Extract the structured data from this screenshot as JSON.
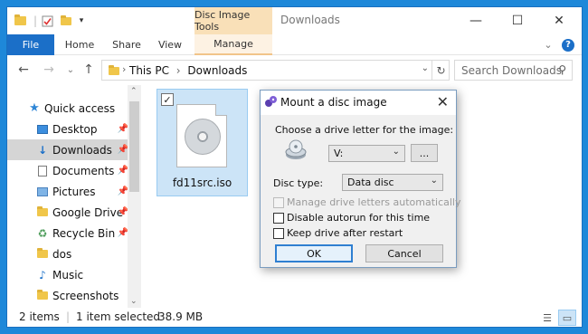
{
  "window": {
    "title": "Downloads",
    "tool_tab": "Disc Image Tools",
    "controls": {
      "minimize": "—",
      "maximize": "☐",
      "close": "✕"
    }
  },
  "ribbon": {
    "tabs": [
      "File",
      "Home",
      "Share",
      "View",
      "Manage"
    ],
    "help": "?"
  },
  "address": {
    "path": [
      "This PC",
      "Downloads"
    ],
    "separator": "›",
    "search_placeholder": "Search Downloads"
  },
  "sidebar": {
    "items": [
      {
        "label": "Quick access",
        "icon": "star-icon",
        "pinned": false
      },
      {
        "label": "Desktop",
        "icon": "desktop-folder-icon",
        "pinned": true
      },
      {
        "label": "Downloads",
        "icon": "downloads-folder-icon",
        "pinned": true,
        "selected": true
      },
      {
        "label": "Documents",
        "icon": "documents-folder-icon",
        "pinned": true
      },
      {
        "label": "Pictures",
        "icon": "pictures-folder-icon",
        "pinned": true
      },
      {
        "label": "Google Drive",
        "icon": "google-drive-icon",
        "pinned": true
      },
      {
        "label": "Recycle Bin",
        "icon": "recycle-bin-icon",
        "pinned": true
      },
      {
        "label": "dos",
        "icon": "folder-icon",
        "pinned": false
      },
      {
        "label": "Music",
        "icon": "music-folder-icon",
        "pinned": false
      },
      {
        "label": "Screenshots",
        "icon": "folder-icon",
        "pinned": false
      }
    ]
  },
  "files": [
    {
      "name": "fd11src.iso",
      "icon": "disc-image-icon",
      "selected": true
    }
  ],
  "status": {
    "count": "2 items",
    "selection": "1 item selected",
    "size": "38.9 MB"
  },
  "dialog": {
    "title": "Mount a disc image",
    "drive_prompt": "Choose a drive letter for the image:",
    "drive_value": "V:",
    "browse_label": "...",
    "disc_type_label": "Disc type:",
    "disc_type_value": "Data disc",
    "options": [
      {
        "label": "Manage drive letters automatically",
        "checked": false,
        "disabled": true
      },
      {
        "label": "Disable autorun for this time",
        "checked": false,
        "disabled": false
      },
      {
        "label": "Keep drive after restart",
        "checked": false,
        "disabled": false
      }
    ],
    "ok_label": "OK",
    "cancel_label": "Cancel"
  },
  "colors": {
    "accent": "#1b6fc8",
    "tool_tab": "#f9e0b8",
    "selection": "#cce4f7",
    "desktop": "#1e88d9"
  }
}
